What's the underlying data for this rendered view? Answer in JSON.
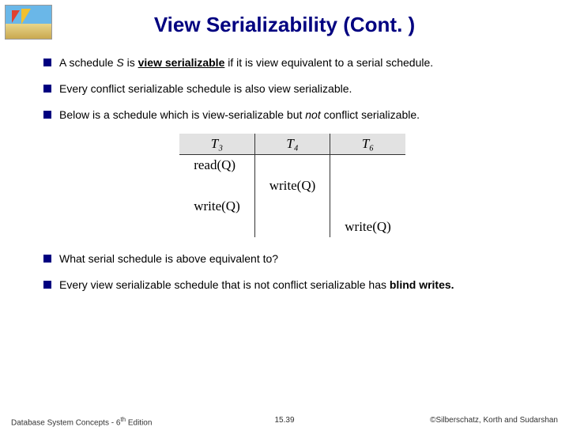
{
  "title": "View Serializability (Cont. )",
  "bullets": {
    "b1_pre": "A schedule ",
    "b1_S": "S",
    "b1_mid": " is ",
    "b1_term": "view serializable",
    "b1_post": " if it is view equivalent to a serial schedule.",
    "b2": "Every conflict serializable schedule is also view serializable.",
    "b3_pre": "Below is a schedule which is view-serializable but ",
    "b3_not": "not",
    "b3_post": " conflict serializable.",
    "b4": "What serial schedule is above equivalent to?",
    "b5_pre": "Every view serializable schedule that is not conflict serializable has ",
    "b5_term": "blind writes."
  },
  "chart_data": {
    "type": "table",
    "headers": [
      "T₃",
      "T₄",
      "T₆"
    ],
    "rows": [
      [
        "read(Q)",
        "",
        ""
      ],
      [
        "",
        "write(Q)",
        ""
      ],
      [
        "write(Q)",
        "",
        ""
      ],
      [
        "",
        "",
        "write(Q)"
      ]
    ]
  },
  "footer": {
    "left_pre": "Database System Concepts - 6",
    "left_sup": "th",
    "left_post": " Edition",
    "center": "15.39",
    "right": "©Silberschatz, Korth and Sudarshan"
  }
}
